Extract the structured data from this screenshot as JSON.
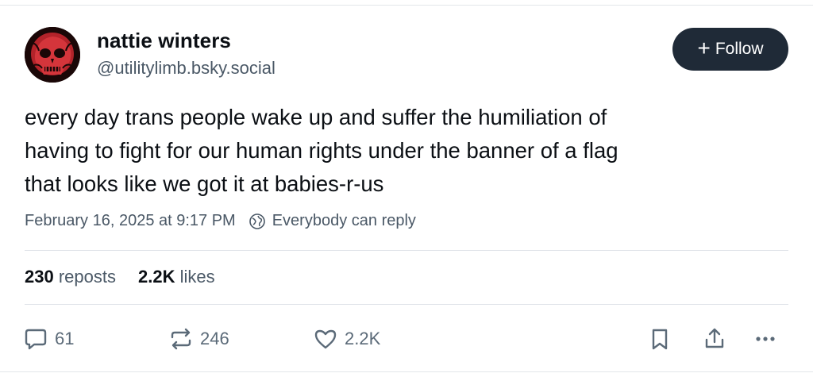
{
  "author": {
    "display_name": "nattie winters",
    "handle": "@utilitylimb.bsky.social",
    "avatar_icon": "red-skull-avatar"
  },
  "follow_button": {
    "label": "Follow",
    "icon": "plus-icon"
  },
  "post": {
    "text_lines": [
      "every day trans people wake up and suffer the humiliation of",
      "having to fight for our human rights under the banner of a flag",
      "that looks like we got it at babies-r-us"
    ]
  },
  "meta": {
    "timestamp": "February 16, 2025 at 9:17 PM",
    "reply_setting": "Everybody can reply",
    "reply_icon": "globe-icon"
  },
  "stats": {
    "reposts_count": "230",
    "reposts_label": "reposts",
    "likes_count": "2.2K",
    "likes_label": "likes"
  },
  "actions": {
    "reply_count": "61",
    "repost_count": "246",
    "like_count": "2.2K"
  },
  "colors": {
    "follow_bg": "#1f2a37",
    "secondary_text": "#4a5866",
    "icon_gray": "#5b6a78"
  }
}
